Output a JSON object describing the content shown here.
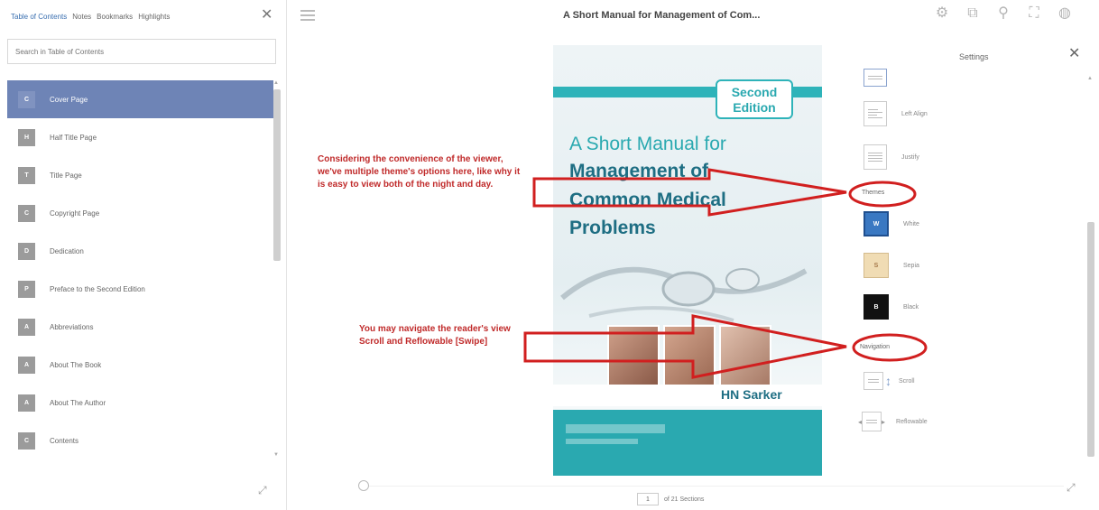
{
  "toc": {
    "tabs": [
      "Table of Contents",
      "Notes",
      "Bookmarks",
      "Highlights"
    ],
    "close_glyph": "✕",
    "search_placeholder": "Search in Table of Contents",
    "items": [
      {
        "badge": "C",
        "label": "Cover Page",
        "active": true
      },
      {
        "badge": "H",
        "label": "Half Title Page"
      },
      {
        "badge": "T",
        "label": "Title Page"
      },
      {
        "badge": "C",
        "label": "Copyright Page"
      },
      {
        "badge": "D",
        "label": "Dedication"
      },
      {
        "badge": "P",
        "label": "Preface to the Second Edition"
      },
      {
        "badge": "A",
        "label": "Abbreviations"
      },
      {
        "badge": "A",
        "label": "About The Book"
      },
      {
        "badge": "A",
        "label": "About The Author"
      },
      {
        "badge": "C",
        "label": "Contents"
      }
    ]
  },
  "header": {
    "title": "A Short Manual for Management of Com...",
    "icons": [
      "gear-icon",
      "external-link-icon",
      "search-icon",
      "fullscreen-icon",
      "user-icon"
    ]
  },
  "cover": {
    "edition_line1": "Second",
    "edition_line2": "Edition",
    "title_line1": "A Short Manual for",
    "title_line2": "Management of",
    "title_line3": "Common Medical",
    "title_line4": "Problems",
    "author": "HN Sarker"
  },
  "annotations": {
    "themes_note": "Considering the convenience of the viewer, we've multiple theme's options here, like why it is easy to view both of the night and day.",
    "navigation_note": "You may navigate the reader's view Scroll and Reflowable [Swipe]"
  },
  "settings": {
    "title": "Settings",
    "close_glyph": "✕",
    "alignment": {
      "left_align": "Left Align",
      "justify": "Justify"
    },
    "themes_label": "Themes",
    "themes": [
      {
        "letter": "W",
        "label": "White",
        "color": "#3a78c2"
      },
      {
        "letter": "S",
        "label": "Sepia",
        "color": "#f0dcb4"
      },
      {
        "letter": "B",
        "label": "Black",
        "color": "#111111"
      }
    ],
    "navigation_label": "Navigation",
    "navigation": {
      "scroll": "Scroll",
      "reflowable": "Reflowable"
    }
  },
  "footer": {
    "current_section": "1",
    "of_text": "of 21 Sections"
  },
  "colors": {
    "accent": "#6e84b6",
    "annotation": "#c02a2a",
    "cover_teal": "#2aa9b0"
  }
}
